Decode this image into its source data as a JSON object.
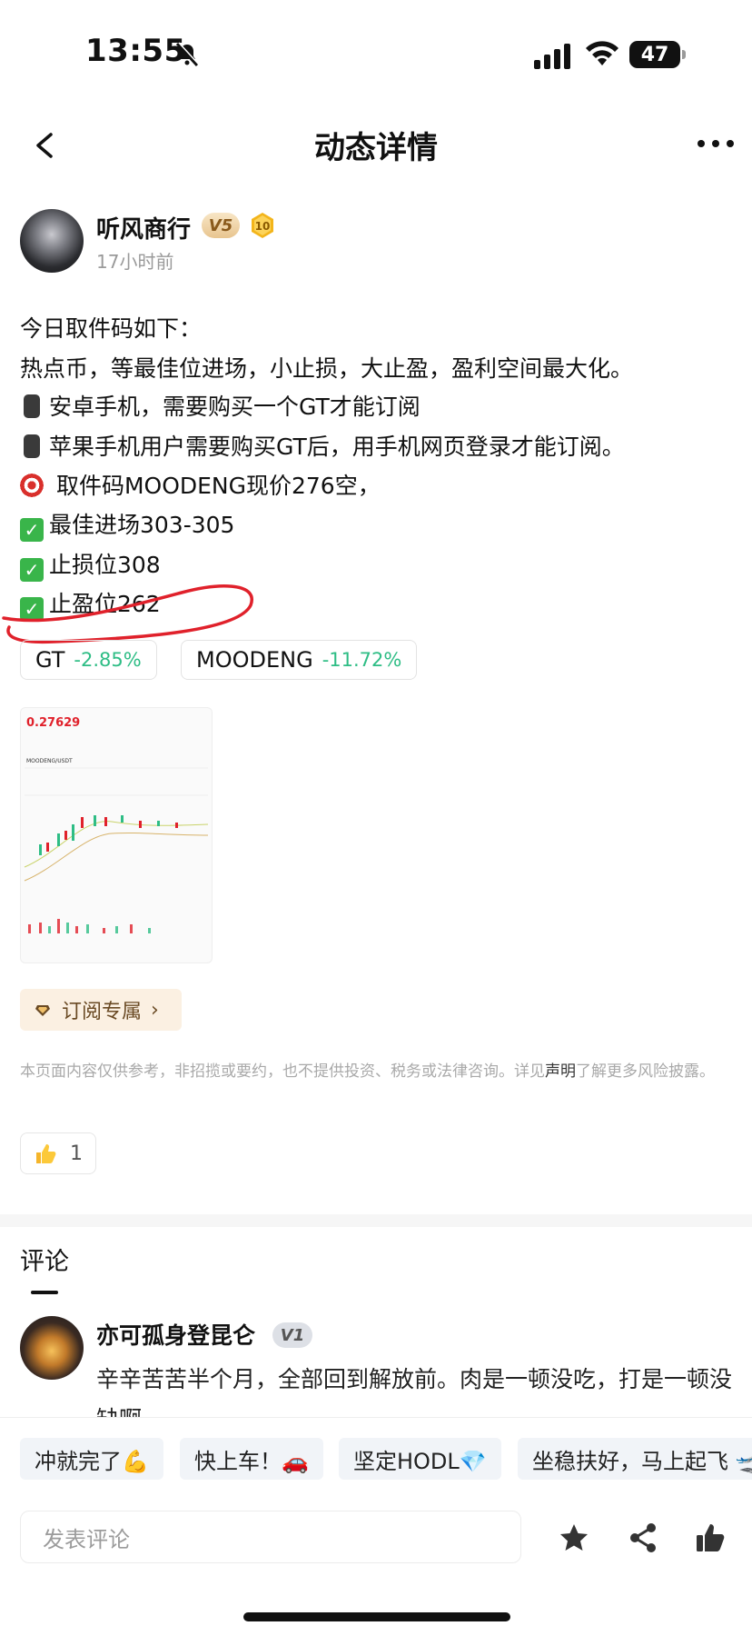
{
  "status_bar": {
    "time": "13:55",
    "battery": "47"
  },
  "nav": {
    "title": "动态详情"
  },
  "author": {
    "name": "听风商行",
    "vip": "V5",
    "level": "10",
    "time": "17小时前"
  },
  "post": {
    "lines": [
      "今日取件码如下：",
      "热点币，等最佳位进场，小止损，大止盈，盈利空间最大化。",
      "安卓手机，需要购买一个GT才能订阅",
      "苹果手机用户需要购买GT后，用手机网页登录才能订阅。",
      " 取件码MOODENG现价276空，",
      "最佳进场303-305",
      "止损位308",
      "止盈位262"
    ],
    "check_mark": "✓"
  },
  "tickers": [
    {
      "symbol": "GT",
      "change": "-2.85%"
    },
    {
      "symbol": "MOODENG",
      "change": "-11.72%"
    }
  ],
  "chart_thumb": {
    "price": "0.27629",
    "pair": "MOODENG/USDT"
  },
  "subscribe": {
    "label": "订阅专属",
    "chevron": "›"
  },
  "disclaimer": {
    "before": "本页面内容仅供参考，非招揽或要约，也不提供投资、税务或法律咨询。详见",
    "link": "声明",
    "after": "了解更多风险披露。"
  },
  "likes": {
    "count": "1"
  },
  "comments": {
    "title": "评论",
    "items": [
      {
        "name": "亦可孤身登昆仑",
        "vip": "V1",
        "text": "辛辛苦苦半个月，全部回到解放前。肉是一顿没吃，打是一顿没缺啊"
      }
    ]
  },
  "quick_replies": [
    "冲就完了💪",
    "快上车！🚗",
    "坚定HODL💎",
    "坐稳扶好，马上起飞 🛫"
  ],
  "input": {
    "placeholder": "发表评论"
  },
  "icons": {
    "back": "chevron-left-icon",
    "more": "more-dots-icon",
    "star": "star-icon",
    "share": "share-icon",
    "like": "thumbs-up-icon"
  },
  "colors": {
    "positive_green": "#2ebd85",
    "annotation_red": "#e0212b",
    "vip_gold": "#e8c58f"
  }
}
